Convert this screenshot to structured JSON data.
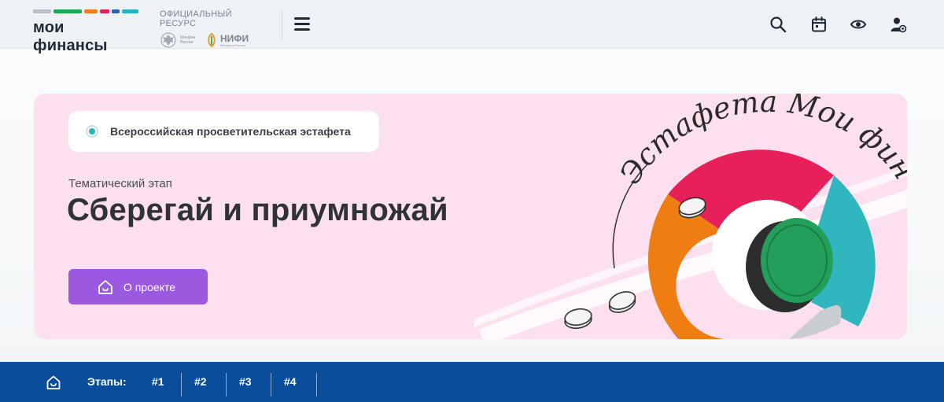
{
  "header": {
    "logo": {
      "text": "мои финансы",
      "stripe_colors": [
        "#b9bec7",
        "#1fa854",
        "#f07d1a",
        "#e11e59",
        "#2d5bb5",
        "#24b3c2"
      ]
    },
    "official_label": "ОФИЦИАЛЬНЫЙ РЕСУРС",
    "partners": {
      "minfin": "Минфин России",
      "nifi": "НИФИ",
      "nifi_sub": "Минфина России"
    },
    "icons": [
      "menu-icon",
      "search-icon",
      "calendar-icon",
      "eye-icon",
      "user-icon"
    ]
  },
  "hero": {
    "badge_text": "Всероссийская просветительская эстафета",
    "stage_label": "Тематический этап",
    "title": "Сберегай и приумножай",
    "about_button": "О проекте",
    "art_caption": "Эстафета Мои финансы",
    "colors": {
      "background": "#fce0ef",
      "button": "#9b59e0",
      "ring_red": "#e8205a",
      "ring_orange": "#f07d12",
      "ring_teal": "#2fb6be",
      "ring_blue": "#164fa0",
      "coin_green": "#22a05a"
    }
  },
  "stages_bar": {
    "label": "Этапы:",
    "items": [
      "#1",
      "#2",
      "#3",
      "#4"
    ],
    "color": "#0b4d9d"
  }
}
